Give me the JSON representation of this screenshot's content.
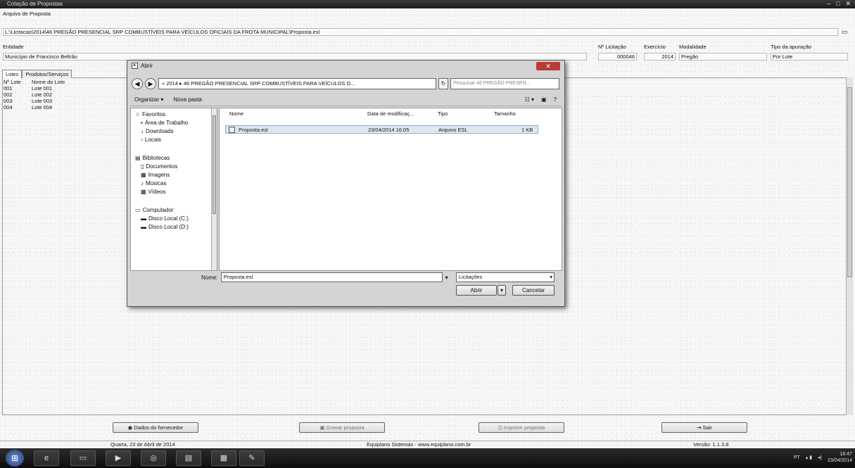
{
  "window": {
    "title": "Cotação de Propostas",
    "controls": [
      "–",
      "□",
      "✕"
    ]
  },
  "header": {
    "arquivo_label": "Arquivo de Proposta",
    "arquivo_path": "L:\\Licitacao\\2014\\46 PREGÃO PRESENCIAL SRP COMBUSTÍVEIS PARA VEÍCULOS OFICIAIS DA FROTA MUNICIPAL\\Proposta.esl",
    "entidade_label": "Entidade",
    "entidade_value": "Município de Francisco Beltrão",
    "licitacao_label": "Nº Licitação",
    "licitacao_value": "000046",
    "exercicio_label": "Exercício",
    "exercicio_value": "2014",
    "modalidade_label": "Modalidade",
    "modalidade_value": "Pregão",
    "apuracao_label": "Tipo da apuração",
    "apuracao_value": "Por Lote"
  },
  "tabs": [
    "Lotes",
    "Produtos/Serviços"
  ],
  "lotes": {
    "headers": [
      "Nº Lote",
      "Nome do Lote"
    ],
    "rows": [
      [
        "001",
        "Lote 001"
      ],
      [
        "002",
        "Lote 002"
      ],
      [
        "003",
        "Lote 003"
      ],
      [
        "004",
        "Lote 004"
      ]
    ]
  },
  "dialog": {
    "title": "Abrir",
    "address": "« 2014 ▸ 46 PREGÃO PRESENCIAL SRP COMBUSTÍVEIS PARA VEÍCULOS O...",
    "search_placeholder": "Pesquisar 46 PREGÃO PRESEN...",
    "organize": "Organizar ▾",
    "new_folder": "Nova pasta",
    "nav_items": [
      "Favoritos",
      "Área de Trabalho",
      "Downloads",
      "Locais",
      "Bibliotecas",
      "Documentos",
      "Imagens",
      "Músicas",
      "Vídeos",
      "Computador",
      "Disco Local (C:)",
      "Disco Local (D:)"
    ],
    "columns": [
      "Nome",
      "Data de modificaç...",
      "Tipo",
      "Tamanho"
    ],
    "file": {
      "name": "Proposta.esl",
      "date": "23/04/2014 16:05",
      "type": "Arquivo ESL",
      "size": "1 KB"
    },
    "name_label": "Nome:",
    "name_value": "Proposta.esl",
    "filter_value": "Licitações",
    "open_label": "Abrir",
    "cancel_label": "Cancelar"
  },
  "bottom_buttons": {
    "fornecedor": "Dados do fornecedor",
    "gravar": "Gravar proposta",
    "imprimir": "Imprimir proposta",
    "sair": "Sair"
  },
  "status": {
    "date": "Quarta, 23 de Abril de 2014",
    "company": "Equiplano Sistemas - www.equiplano.com.br",
    "version": "Versão: 1.1.3.8"
  },
  "taskbar": {
    "lang": "PT",
    "time": "16:47",
    "date": "23/04/2014"
  }
}
